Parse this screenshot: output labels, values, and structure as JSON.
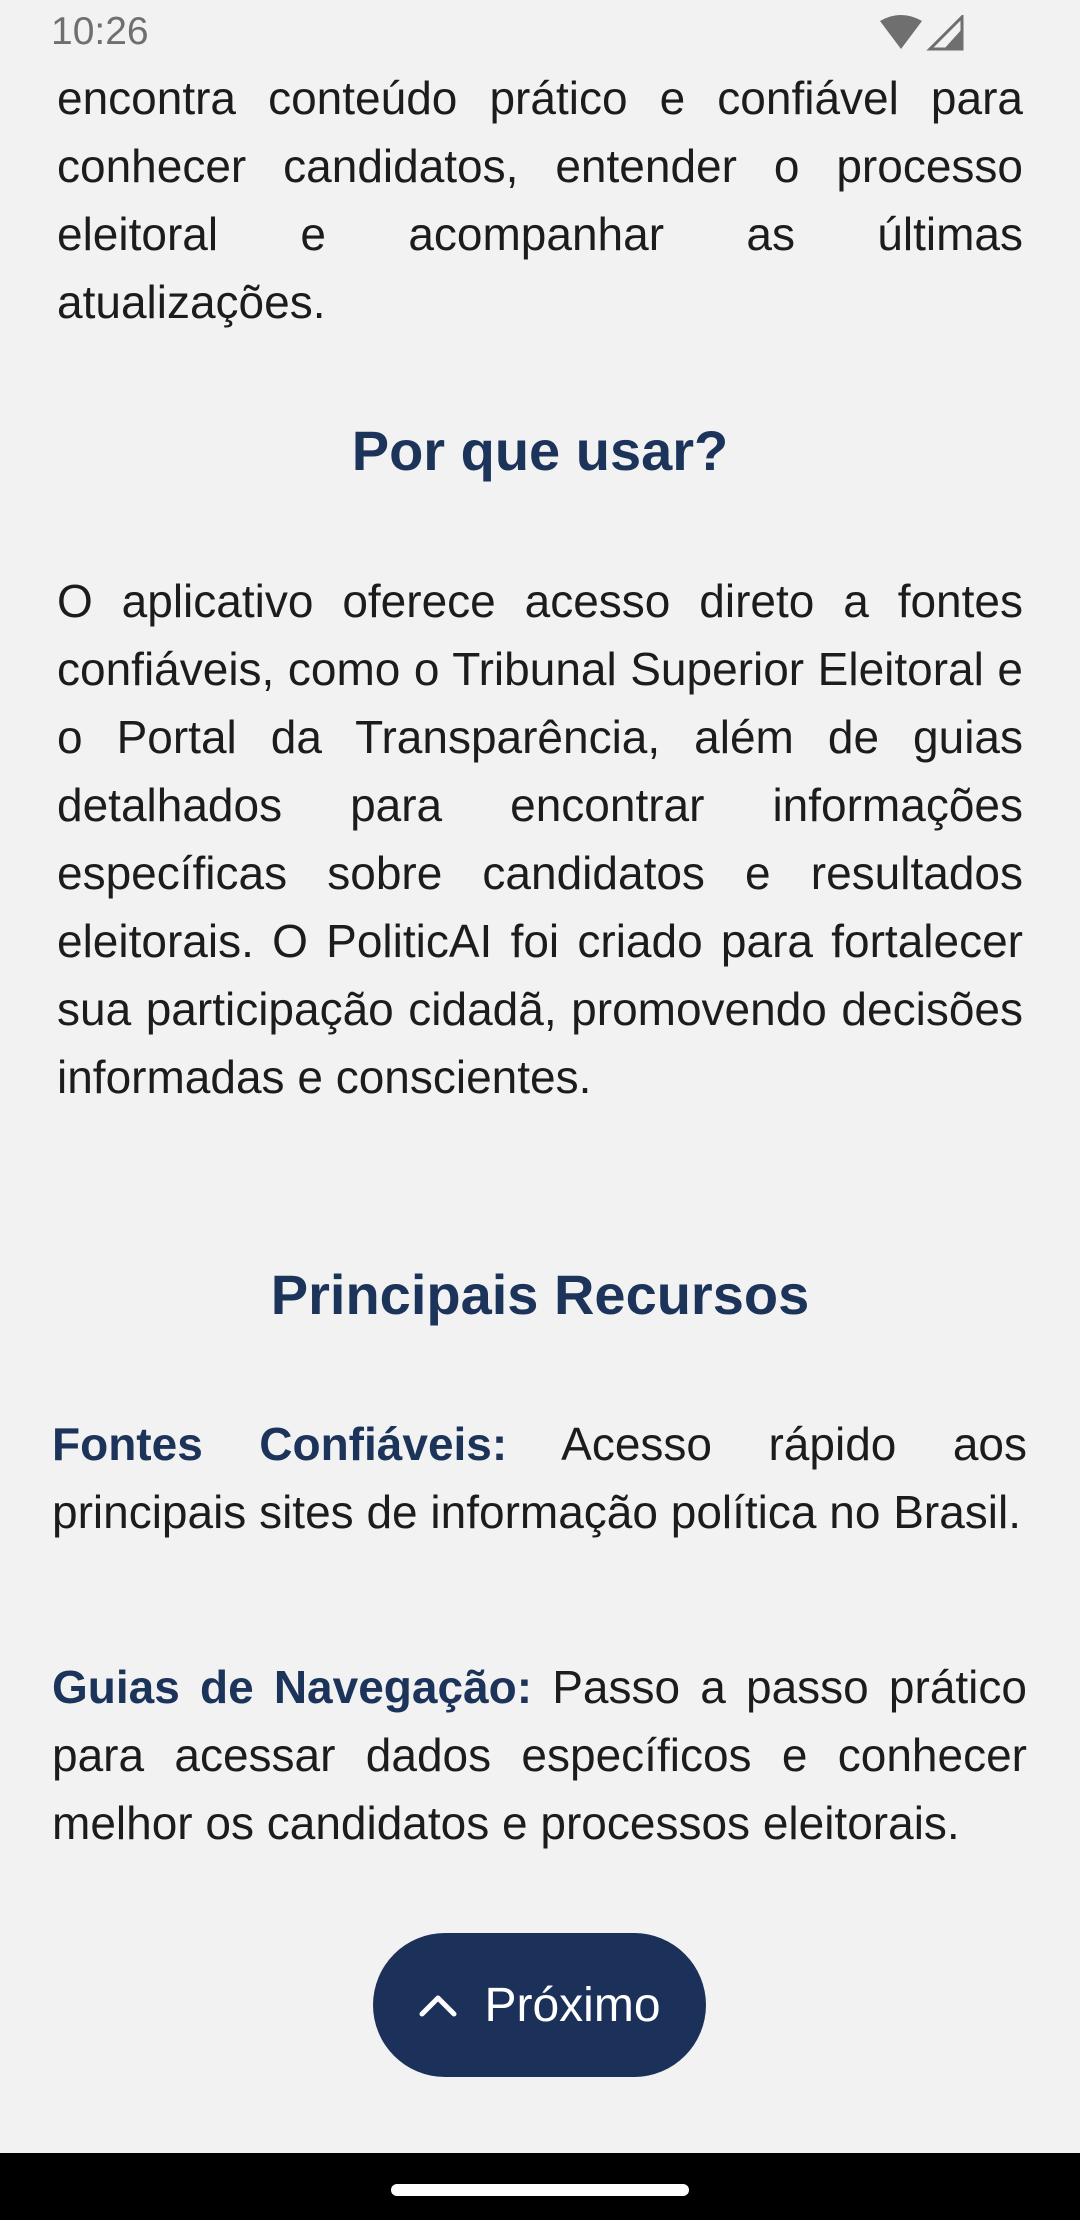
{
  "status_bar": {
    "time": "10:26",
    "icons": [
      "wifi-icon",
      "cell-signal-icon"
    ]
  },
  "intro": {
    "text": "encontra conteúdo prático e confiável para conhecer candidatos, entender o processo eleitoral e acompanhar as últimas atualizações."
  },
  "why_section": {
    "heading": "Por que usar?",
    "text": "O aplicativo oferece acesso direto a fontes confiáveis, como o Tribunal Superior Eleitoral e o Portal da Transparência, além de guias detalhados para encontrar informações específicas sobre candidatos e resultados eleitorais. O PoliticAI foi criado para fortalecer sua participação cidadã, promovendo decisões informadas e conscientes."
  },
  "features_section": {
    "heading": "Principais Recursos",
    "items": [
      {
        "title": "Fontes Confiáveis:",
        "description": " Acesso rápido aos principais sites de informação política no Brasil."
      },
      {
        "title": "Guias de Navegação:",
        "description": " Passo a passo prático para acessar dados específicos e conhecer melhor os candidatos e processos eleitorais."
      }
    ]
  },
  "next_button": {
    "label": "Próximo",
    "icon": "chevron-up-icon"
  },
  "colors": {
    "background": "#f2f2f3",
    "accent": "#1c335a",
    "button": "#1b315a",
    "text": "#1c1c1c"
  }
}
